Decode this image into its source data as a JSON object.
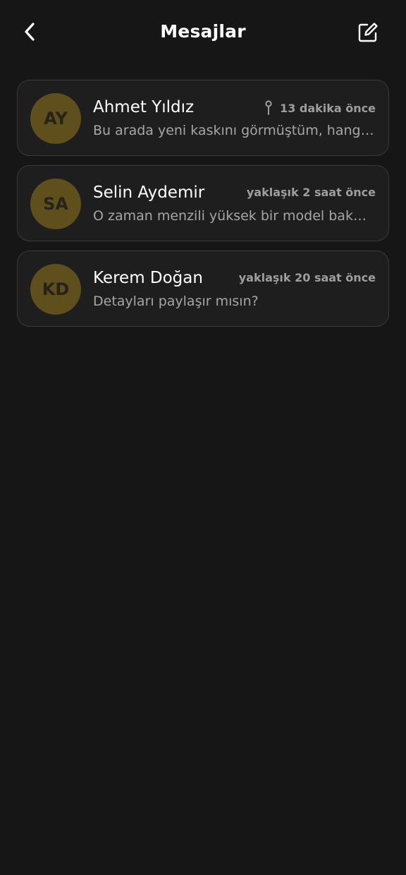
{
  "header": {
    "title": "Mesajlar",
    "back_icon": "chevron-left-icon",
    "compose_icon": "compose-icon"
  },
  "colors": {
    "background": "#161616",
    "card": "#1e1e1e",
    "card_border": "#3a3a3a",
    "avatar": "#5e4f1c",
    "muted_text": "#a6a6a6"
  },
  "conversations": [
    {
      "initials": "AY",
      "name": "Ahmet Yıldız",
      "time": "13 dakika önce",
      "pinned": true,
      "preview": "Bu arada yeni kaskını görmüştüm, hangi marka?"
    },
    {
      "initials": "SA",
      "name": "Selin Aydemir",
      "time": "yaklaşık 2 saat önce",
      "pinned": false,
      "preview": "O zaman menzili yüksek bir model bakmalısın"
    },
    {
      "initials": "KD",
      "name": "Kerem Doğan",
      "time": "yaklaşık 20 saat önce",
      "pinned": false,
      "preview": "Detayları paylaşır mısın?"
    }
  ]
}
